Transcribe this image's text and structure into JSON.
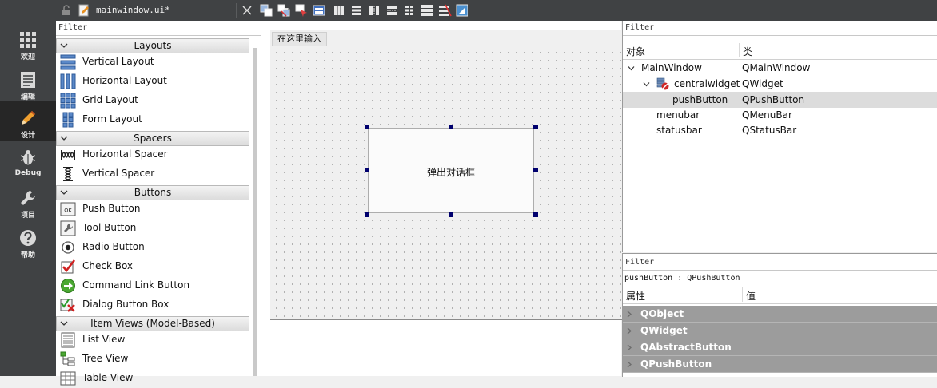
{
  "modebar": {
    "items": [
      {
        "label": "欢迎",
        "icon": "grid-icon"
      },
      {
        "label": "编辑",
        "icon": "document-icon"
      },
      {
        "label": "设计",
        "icon": "pencil-icon"
      },
      {
        "label": "Debug",
        "icon": "bug-icon"
      },
      {
        "label": "项目",
        "icon": "wrench-icon"
      },
      {
        "label": "帮助",
        "icon": "help-icon"
      }
    ],
    "active": "设计"
  },
  "toolbar": {
    "file_name": "mainwindow.ui*"
  },
  "widgetbox": {
    "filter_placeholder": "Filter",
    "categories": [
      {
        "title": "Layouts",
        "items": [
          "Vertical Layout",
          "Horizontal Layout",
          "Grid Layout",
          "Form Layout"
        ]
      },
      {
        "title": "Spacers",
        "items": [
          "Horizontal Spacer",
          "Vertical Spacer"
        ]
      },
      {
        "title": "Buttons",
        "items": [
          "Push Button",
          "Tool Button",
          "Radio Button",
          "Check Box",
          "Command Link Button",
          "Dialog Button Box"
        ]
      },
      {
        "title": "Item Views (Model-Based)",
        "items": [
          "List View",
          "Tree View",
          "Table View"
        ]
      }
    ]
  },
  "canvas": {
    "menu_placeholder": "在这里输入",
    "push_button_text": "弹出对话框"
  },
  "object_inspector": {
    "filter_placeholder": "Filter",
    "col_object": "对象",
    "col_class": "类",
    "rows": [
      {
        "name": "MainWindow",
        "class": "QMainWindow"
      },
      {
        "name": "centralwidget",
        "class": "QWidget"
      },
      {
        "name": "pushButton",
        "class": "QPushButton"
      },
      {
        "name": "menubar",
        "class": "QMenuBar"
      },
      {
        "name": "statusbar",
        "class": "QStatusBar"
      }
    ]
  },
  "property_editor": {
    "filter_placeholder": "Filter",
    "current_object": "pushButton : QPushButton",
    "col_property": "属性",
    "col_value": "值",
    "groups": [
      "QObject",
      "QWidget",
      "QAbstractButton",
      "QPushButton"
    ]
  },
  "colors": {
    "sidebar_bg": "#404244",
    "sidebar_active": "#262626",
    "accent_pencil": "#f0a030",
    "selection_handle": "#00006e",
    "group_header": "#9c9c9c"
  }
}
